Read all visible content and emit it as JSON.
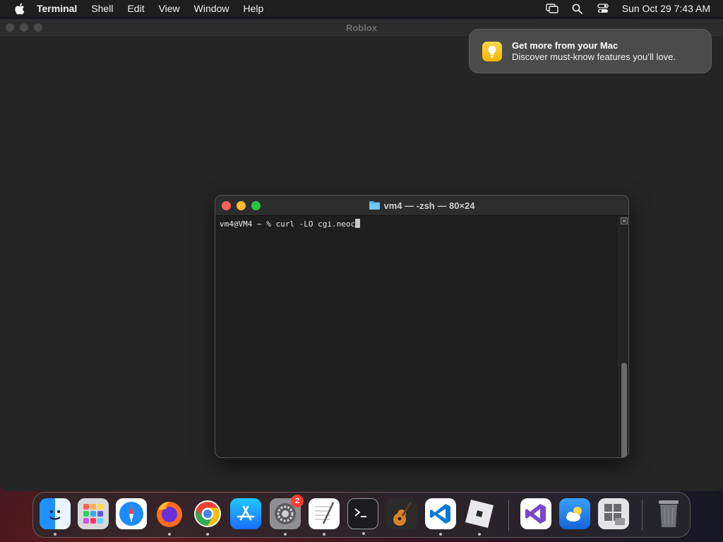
{
  "menubar": {
    "app_name": "Terminal",
    "items": [
      "Shell",
      "Edit",
      "View",
      "Window",
      "Help"
    ],
    "clock": "Sun Oct 29  7:43 AM"
  },
  "background_window": {
    "title": "Roblox"
  },
  "notification": {
    "title": "Get more from your Mac",
    "body": "Discover must-know features you’ll love."
  },
  "terminal": {
    "title": "vm4 — -zsh — 80×24",
    "prompt": "vm4@VM4 ~ % ",
    "command": "curl -LO cgi.neoc"
  },
  "dock": {
    "items": [
      "finder-icon",
      "launchpad-icon",
      "safari-icon",
      "firefox-icon",
      "chrome-icon",
      "app-store-icon",
      "system-settings-icon",
      "textedit-icon",
      "terminal-icon",
      "garageband-icon",
      "vscode-icon",
      "roblox-icon",
      "visual-studio-icon",
      "weather-icon",
      "boot-camp-icon",
      "trash-icon"
    ],
    "settings_badge": "2"
  },
  "colors": {
    "close": "#fe5f57",
    "minimize": "#febc2e",
    "maximize": "#28c840",
    "badge": "#ff3b30"
  }
}
